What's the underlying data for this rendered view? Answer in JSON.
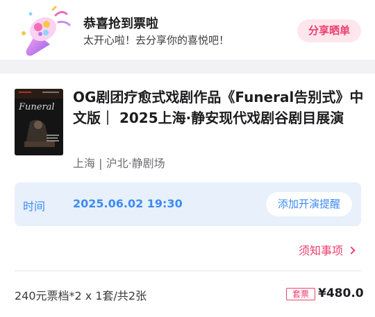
{
  "banner": {
    "title": "恭喜抢到票啦",
    "subtitle": "太开心啦！去分享你的喜悦吧！",
    "share_label": "分享晒单"
  },
  "show": {
    "poster_text": "Funeral",
    "title": "OG剧团疗愈式戏剧作品《Funeral告别式》中文版｜ 2025上海·静安现代戏剧谷剧目展演",
    "venue": "上海 | 沪北·静剧场"
  },
  "schedule": {
    "label": "时间",
    "datetime": "2025.06.02 19:30",
    "remind_label": "添加开演提醒"
  },
  "notice": {
    "label": "须知事项"
  },
  "order": {
    "ticket_summary": "240元票档*2 x 1套/共2张",
    "badge": "套票",
    "total": "¥480.0"
  },
  "colors": {
    "accent_pink": "#ee3e6e",
    "accent_blue": "#3d8bf2",
    "time_box_bg": "#e7f0fb"
  }
}
